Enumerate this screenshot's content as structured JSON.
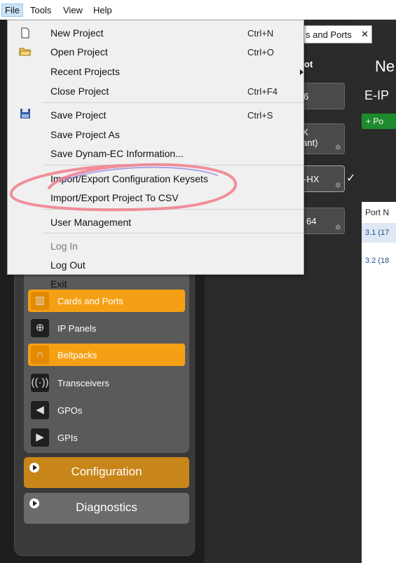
{
  "menubar": {
    "items": [
      "File",
      "Tools",
      "View",
      "Help"
    ]
  },
  "file_menu": {
    "items": [
      {
        "label": "New Project",
        "shortcut": "Ctrl+N",
        "icon": "new-document-icon"
      },
      {
        "label": "Open Project",
        "shortcut": "Ctrl+O",
        "icon": "open-folder-icon"
      },
      {
        "label": "Recent Projects",
        "shortcut": "",
        "icon": "",
        "submenu": true
      },
      {
        "label": "Close Project",
        "shortcut": "Ctrl+F4",
        "icon": ""
      },
      {
        "label": "Save Project",
        "shortcut": "Ctrl+S",
        "icon": "save-floppy-icon"
      },
      {
        "label": "Save Project As",
        "shortcut": "",
        "icon": ""
      },
      {
        "label": "Save Dynam-EC Information...",
        "shortcut": "",
        "icon": ""
      },
      {
        "label": "Import/Export Configuration Keysets",
        "shortcut": "",
        "icon": ""
      },
      {
        "label": "Import/Export Project To CSV",
        "shortcut": "",
        "icon": ""
      },
      {
        "label": "User Management",
        "shortcut": "",
        "icon": ""
      },
      {
        "label": "Log In",
        "shortcut": "",
        "icon": "",
        "disabled": true
      },
      {
        "label": "Log Out",
        "shortcut": "",
        "icon": ""
      },
      {
        "label": "Exit",
        "shortcut": "",
        "icon": ""
      }
    ]
  },
  "tab": {
    "label": "s and Ports"
  },
  "devices": {
    "header": "ot",
    "items": [
      "6",
      "X\nant)",
      "-HX",
      "64"
    ]
  },
  "right": {
    "title": "Ne",
    "subtitle": "E-IP",
    "add_button": "+ Po",
    "table_header": "Port N",
    "rows": [
      "3.1 (17",
      "3.2 (18"
    ]
  },
  "nav": {
    "items": [
      {
        "label": "Cards and Ports",
        "icon": "cards-icon",
        "active": true
      },
      {
        "label": "IP Panels",
        "icon": "ip-panel-icon",
        "active": false
      },
      {
        "label": "Beltpacks",
        "icon": "headset-icon",
        "active": true
      },
      {
        "label": "Transceivers",
        "icon": "antenna-icon",
        "active": false
      },
      {
        "label": "GPOs",
        "icon": "gpo-icon",
        "active": false
      },
      {
        "label": "GPIs",
        "icon": "gpi-icon",
        "active": false
      }
    ],
    "sections": [
      "Configuration",
      "Diagnostics"
    ]
  },
  "colors": {
    "accent_orange": "#f5a014",
    "section_orange": "#c8851a",
    "menu_highlight": "#cce4f7",
    "annotation_pink": "#f07c8c",
    "annotation_purple": "#9a8fe0"
  }
}
